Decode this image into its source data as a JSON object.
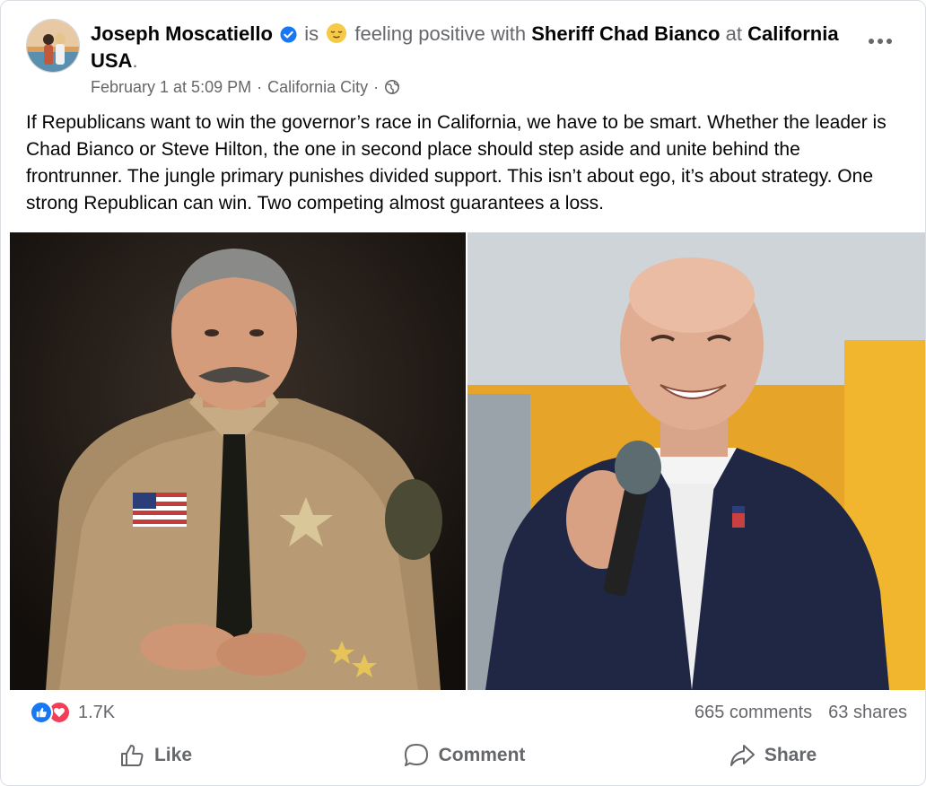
{
  "post": {
    "author": "Joseph Moscatiello",
    "is_text": "is",
    "feeling_text": "feeling positive with",
    "tagged": "Sheriff Chad Bianco",
    "at_text": "at",
    "location_link": "California USA",
    "location_suffix": ".",
    "timestamp": "February 1 at 5:09 PM",
    "separator": "·",
    "place": "California City",
    "text": "If Republicans want to win the governor’s race in California, we have to be smart. Whether the leader is Chad Bianco or Steve Hilton, the one in second place should step aside and unite behind the frontrunner. The jungle primary punishes divided support. This isn’t about ego, it’s about strategy. One strong Republican can win. Two competing almost guarantees a loss."
  },
  "icons": {
    "verified": "verified-badge-icon",
    "feeling": "relieved-face-emoji",
    "audience": "globe-icon",
    "more": "ellipsis-icon",
    "like_reaction": "thumbs-up-icon",
    "love_reaction": "heart-icon"
  },
  "stats": {
    "reactions": "1.7K",
    "comments": "665 comments",
    "shares": "63 shares"
  },
  "actions": {
    "like": "Like",
    "comment": "Comment",
    "share": "Share"
  },
  "colors": {
    "brand_blue": "#1877f2",
    "love_red": "#f33e58",
    "secondary_text": "#65676b"
  }
}
